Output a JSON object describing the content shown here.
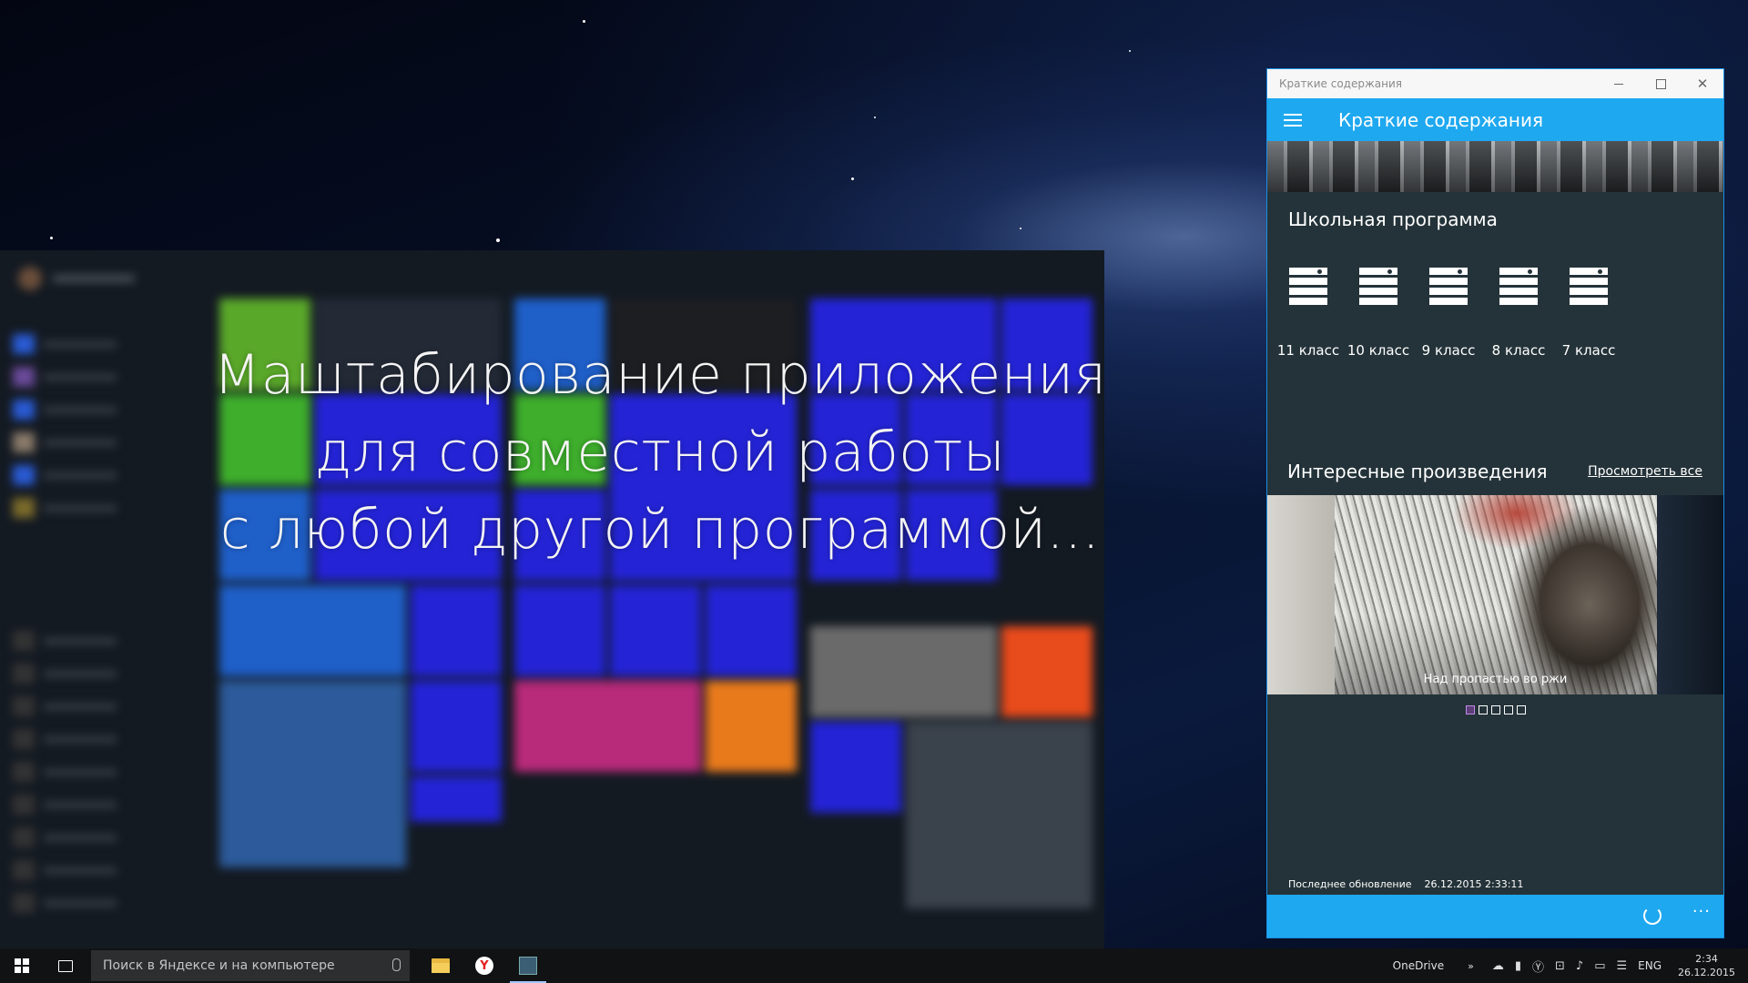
{
  "overlay": {
    "line1": "Маштабирование приложения",
    "line2": "для совместной работы",
    "line3": "с любой другой программой..."
  },
  "window": {
    "title": "Краткие содержания",
    "app_title": "Краткие содержания",
    "school_section": "Школьная программа",
    "grades": [
      "11 класс",
      "10 класс",
      "9 класс",
      "8 класс",
      "7 класс"
    ],
    "works_section": "Интересные произведения",
    "view_all": "Просмотреть все",
    "slide_caption": "Над пропастью во ржи",
    "slides_total": 5,
    "slide_active": 1,
    "updated_label": "Последнее обновление",
    "updated_value": "26.12.2015 2:33:11",
    "more_label": "···"
  },
  "taskbar": {
    "search_placeholder": "Поиск в Яндексе и на компьютере",
    "onedrive": "OneDrive",
    "lang": "ENG",
    "time": "2:34",
    "date": "26.12.2015",
    "yandex_letter": "Y"
  },
  "colors": {
    "accent": "#1ea8ef",
    "app_bg": "#243339",
    "tile_blue": "#2424d6",
    "tile_green": "#3eae2c",
    "tile_orange": "#e84b1c"
  }
}
